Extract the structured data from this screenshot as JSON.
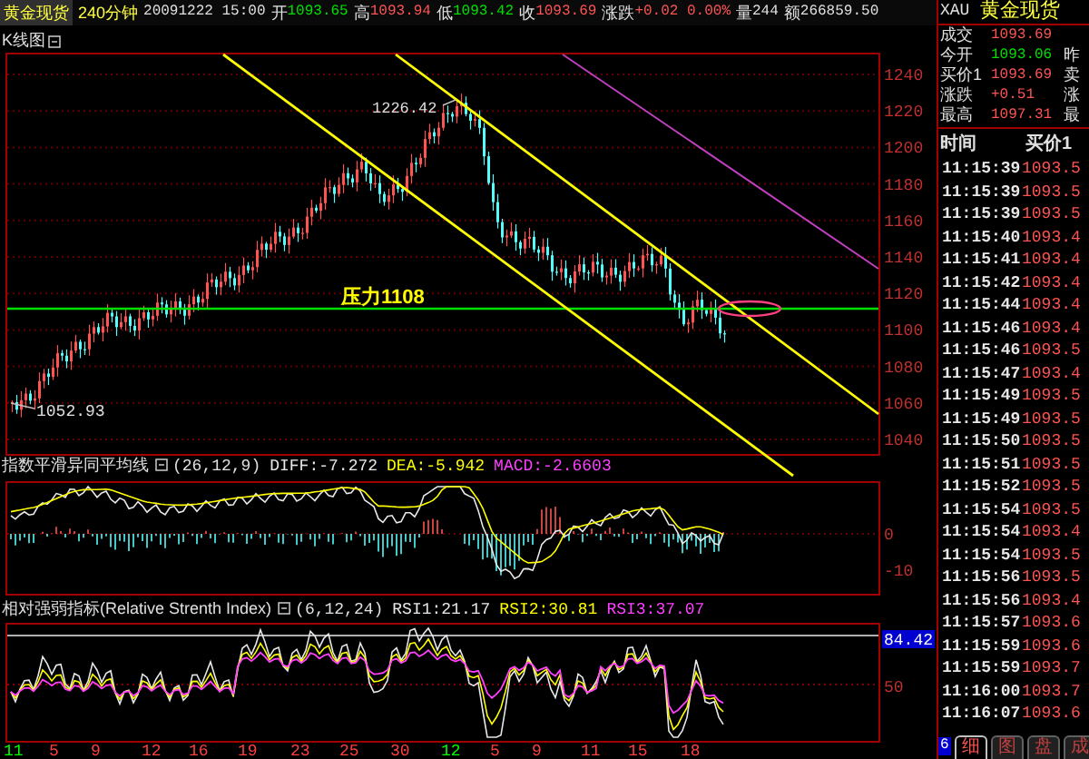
{
  "header": {
    "symbol": "黄金现货",
    "period": "240分钟",
    "datetime": "20091222 15:00",
    "fields": [
      {
        "label": "开",
        "value": "1093.65",
        "color": "#00e000"
      },
      {
        "label": "高",
        "value": "1093.94",
        "color": "#ff5454"
      },
      {
        "label": "低",
        "value": "1093.42",
        "color": "#00e000"
      },
      {
        "label": "收",
        "value": "1093.69",
        "color": "#ff5454"
      },
      {
        "label": "涨跌",
        "value": "+0.02 0.00%",
        "color": "#ff5454"
      },
      {
        "label": "量",
        "value": "244",
        "color": "#e0e0e0"
      },
      {
        "label": "额",
        "value": "266859.50",
        "color": "#e0e0e0"
      }
    ]
  },
  "main_chart": {
    "title": "K线图",
    "price_labels": [
      "1240",
      "1220",
      "1200",
      "1180",
      "1160",
      "1140",
      "1120",
      "1100",
      "1080",
      "1060",
      "1040"
    ],
    "annotations": [
      {
        "kind": "high",
        "text": "1226.42"
      },
      {
        "kind": "low",
        "text": "1052.93"
      },
      {
        "kind": "resistance",
        "text": "压力1108"
      }
    ]
  },
  "macd": {
    "title": "指数平滑异同平均线",
    "params": "(26,12,9)",
    "values": [
      {
        "text": "DIFF:-7.272",
        "color": "#e8e8e8"
      },
      {
        "text": "DEA:-5.942",
        "color": "#ffff00"
      },
      {
        "text": "MACD:-2.6603",
        "color": "#ff40ff"
      }
    ],
    "axis_labels": [
      {
        "text": "0",
        "highlighted": false
      },
      {
        "text": "-10",
        "highlighted": false
      }
    ]
  },
  "rsi": {
    "title": "相对强弱指标(Relative Strenth Index)",
    "params": "(6,12,24)",
    "values": [
      {
        "text": "RSI1:21.17",
        "color": "#e8e8e8"
      },
      {
        "text": "RSI2:30.81",
        "color": "#ffff00"
      },
      {
        "text": "RSI3:37.07",
        "color": "#ff40ff"
      }
    ],
    "axis_labels": [
      {
        "text": "84.42",
        "highlighted": true
      },
      {
        "text": "50",
        "highlighted": false
      }
    ]
  },
  "dates": [
    {
      "text": "11",
      "color": "#00ff00"
    },
    {
      "text": "5",
      "color": "#ff4040"
    },
    {
      "text": "9",
      "color": "#ff4040"
    },
    {
      "text": "12",
      "color": "#ff4040"
    },
    {
      "text": "16",
      "color": "#ff4040"
    },
    {
      "text": "19",
      "color": "#ff4040"
    },
    {
      "text": "23",
      "color": "#ff4040"
    },
    {
      "text": "25",
      "color": "#ff4040"
    },
    {
      "text": "30",
      "color": "#ff4040"
    },
    {
      "text": "12",
      "color": "#00ff00"
    },
    {
      "text": "5",
      "color": "#ff4040"
    },
    {
      "text": "9",
      "color": "#ff4040"
    },
    {
      "text": "11",
      "color": "#ff4040"
    },
    {
      "text": "15",
      "color": "#ff4040"
    },
    {
      "text": "18",
      "color": "#ff4040"
    }
  ],
  "quote": {
    "code": "XAU",
    "name": "黄金现货",
    "rows": [
      {
        "label": "成交",
        "value": "1093.69",
        "color": "#ff5454"
      },
      {
        "label": "今开",
        "value": "1093.06",
        "color": "#00e000",
        "label2": "昨"
      },
      {
        "label": "买价1",
        "value": "1093.69",
        "color": "#ff5454",
        "label2": "卖"
      },
      {
        "label": "涨跌",
        "value": "+0.51",
        "color": "#ff5454",
        "label2": "涨"
      },
      {
        "label": "最高",
        "value": "1097.31",
        "color": "#ff5454",
        "label2": "最"
      }
    ]
  },
  "trades": {
    "columns": [
      "时间",
      "买价1"
    ],
    "rows": [
      {
        "time": "11:15:39",
        "price": "1093.5"
      },
      {
        "time": "11:15:39",
        "price": "1093.5"
      },
      {
        "time": "11:15:39",
        "price": "1093.5"
      },
      {
        "time": "11:15:40",
        "price": "1093.4"
      },
      {
        "time": "11:15:41",
        "price": "1093.4"
      },
      {
        "time": "11:15:42",
        "price": "1093.4"
      },
      {
        "time": "11:15:44",
        "price": "1093.4"
      },
      {
        "time": "11:15:46",
        "price": "1093.4"
      },
      {
        "time": "11:15:46",
        "price": "1093.5"
      },
      {
        "time": "11:15:47",
        "price": "1093.4"
      },
      {
        "time": "11:15:49",
        "price": "1093.5"
      },
      {
        "time": "11:15:49",
        "price": "1093.5"
      },
      {
        "time": "11:15:50",
        "price": "1093.5"
      },
      {
        "time": "11:15:51",
        "price": "1093.5"
      },
      {
        "time": "11:15:52",
        "price": "1093.5"
      },
      {
        "time": "11:15:54",
        "price": "1093.5"
      },
      {
        "time": "11:15:54",
        "price": "1093.4"
      },
      {
        "time": "11:15:54",
        "price": "1093.5"
      },
      {
        "time": "11:15:56",
        "price": "1093.5"
      },
      {
        "time": "11:15:56",
        "price": "1093.4"
      },
      {
        "time": "11:15:57",
        "price": "1093.6"
      },
      {
        "time": "11:15:59",
        "price": "1093.6"
      },
      {
        "time": "11:15:59",
        "price": "1093.7"
      },
      {
        "time": "11:16:00",
        "price": "1093.7"
      },
      {
        "time": "11:16:07",
        "price": "1093.6"
      }
    ]
  },
  "tab_marker": "6",
  "tabs": [
    {
      "label": "细",
      "selected": true
    },
    {
      "label": "图",
      "selected": false
    },
    {
      "label": "盘",
      "selected": false
    },
    {
      "label": "成",
      "selected": false
    }
  ]
}
